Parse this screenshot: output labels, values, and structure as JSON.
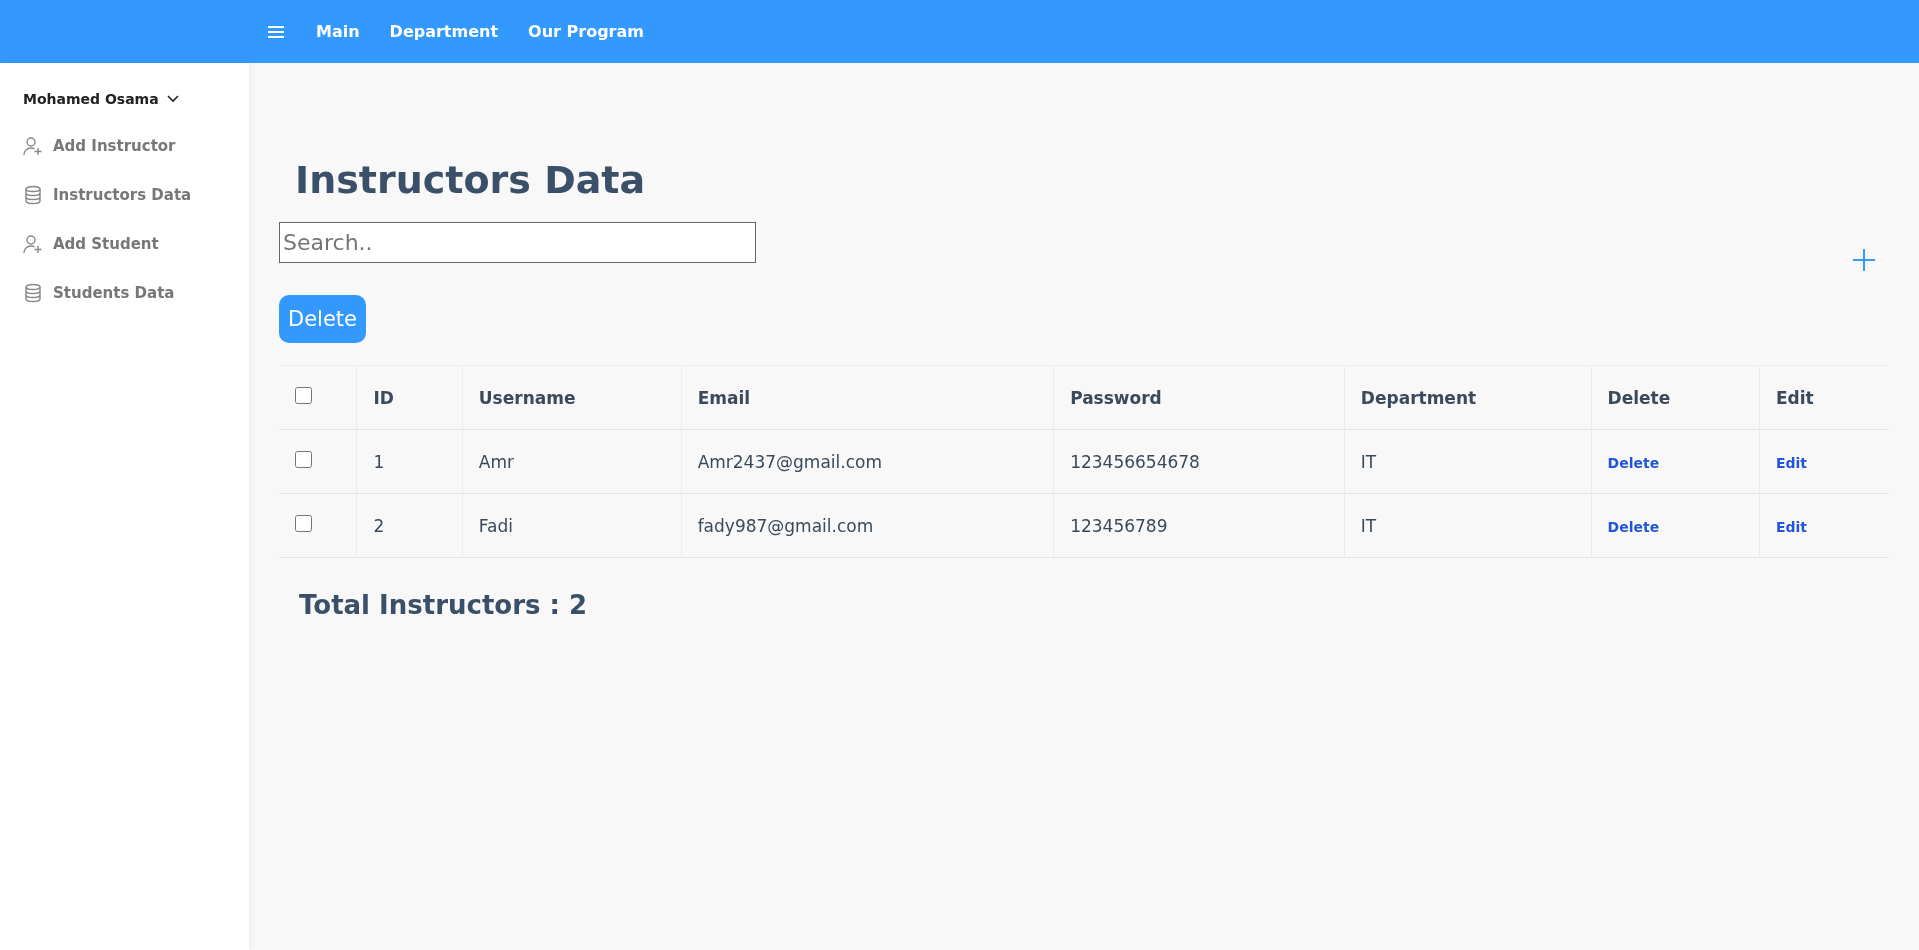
{
  "navbar": {
    "links": [
      "Main",
      "Department",
      "Our Program"
    ]
  },
  "sidebar": {
    "user": "Mohamed Osama",
    "items": [
      {
        "label": "Add Instructor",
        "kind": "add-user"
      },
      {
        "label": "Instructors Data",
        "kind": "database"
      },
      {
        "label": "Add Student",
        "kind": "add-user"
      },
      {
        "label": "Students Data",
        "kind": "database"
      }
    ]
  },
  "page": {
    "title": "Instructors Data",
    "search": {
      "placeholder": "Search.."
    },
    "delete_button": "Delete"
  },
  "table": {
    "columns": [
      "ID",
      "Username",
      "Email",
      "Password",
      "Department",
      "Delete",
      "Edit"
    ],
    "header_checked": false,
    "rows": [
      {
        "checked": false,
        "cells": [
          "1",
          "Amr",
          "Amr2437@gmail.com",
          "123456654678",
          "IT"
        ],
        "delete": "Delete",
        "edit": "Edit"
      },
      {
        "checked": false,
        "cells": [
          "2",
          "Fadi",
          "fady987@gmail.com",
          "123456789",
          "IT"
        ],
        "delete": "Delete",
        "edit": "Edit"
      }
    ]
  },
  "total": "Total Instructors : 2"
}
